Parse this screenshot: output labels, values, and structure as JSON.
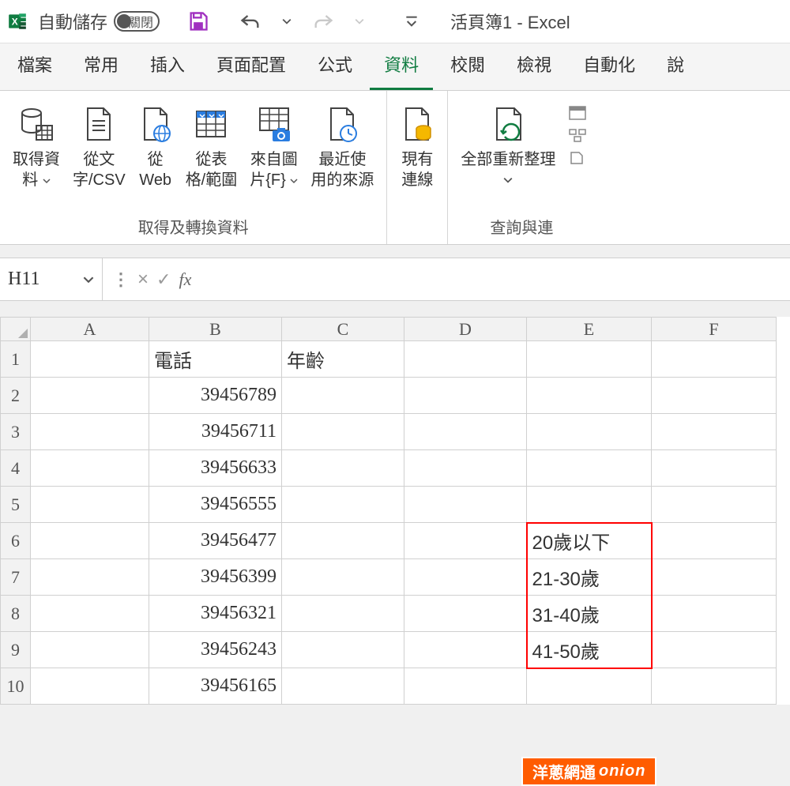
{
  "titlebar": {
    "autosave_label": "自動儲存",
    "toggle_state": "關閉",
    "doc_title": "活頁簿1 - Excel"
  },
  "tabs": [
    "檔案",
    "常用",
    "插入",
    "頁面配置",
    "公式",
    "資料",
    "校閱",
    "檢視",
    "自動化",
    "說"
  ],
  "active_tab_index": 5,
  "ribbon": {
    "group1_label": "取得及轉換資料",
    "group2_label": "查詢與連",
    "btn_get_data": "取得資\n料",
    "btn_from_csv": "從文\n字/CSV",
    "btn_from_web": "從\nWeb",
    "btn_from_table": "從表\n格/範圍",
    "btn_from_image": "來自圖\n片{F}",
    "btn_recent": "最近使\n用的來源",
    "btn_existing": "現有\n連線",
    "btn_refresh": "全部重新整理"
  },
  "formula_bar": {
    "name_box": "H11",
    "formula": ""
  },
  "grid": {
    "columns": [
      "A",
      "B",
      "C",
      "D",
      "E",
      "F"
    ],
    "row_count": 10,
    "headers": {
      "B1": "電話",
      "C1": "年齡"
    },
    "phone_values": [
      "39456789",
      "39456711",
      "39456633",
      "39456555",
      "39456477",
      "39456399",
      "39456321",
      "39456243",
      "39456165"
    ],
    "e_values": {
      "6": "20歲以下",
      "7": "21-30歲",
      "8": "31-40歲",
      "9": "41-50歲"
    }
  },
  "watermark": {
    "zh": "洋蔥網通",
    "en": "onion"
  }
}
